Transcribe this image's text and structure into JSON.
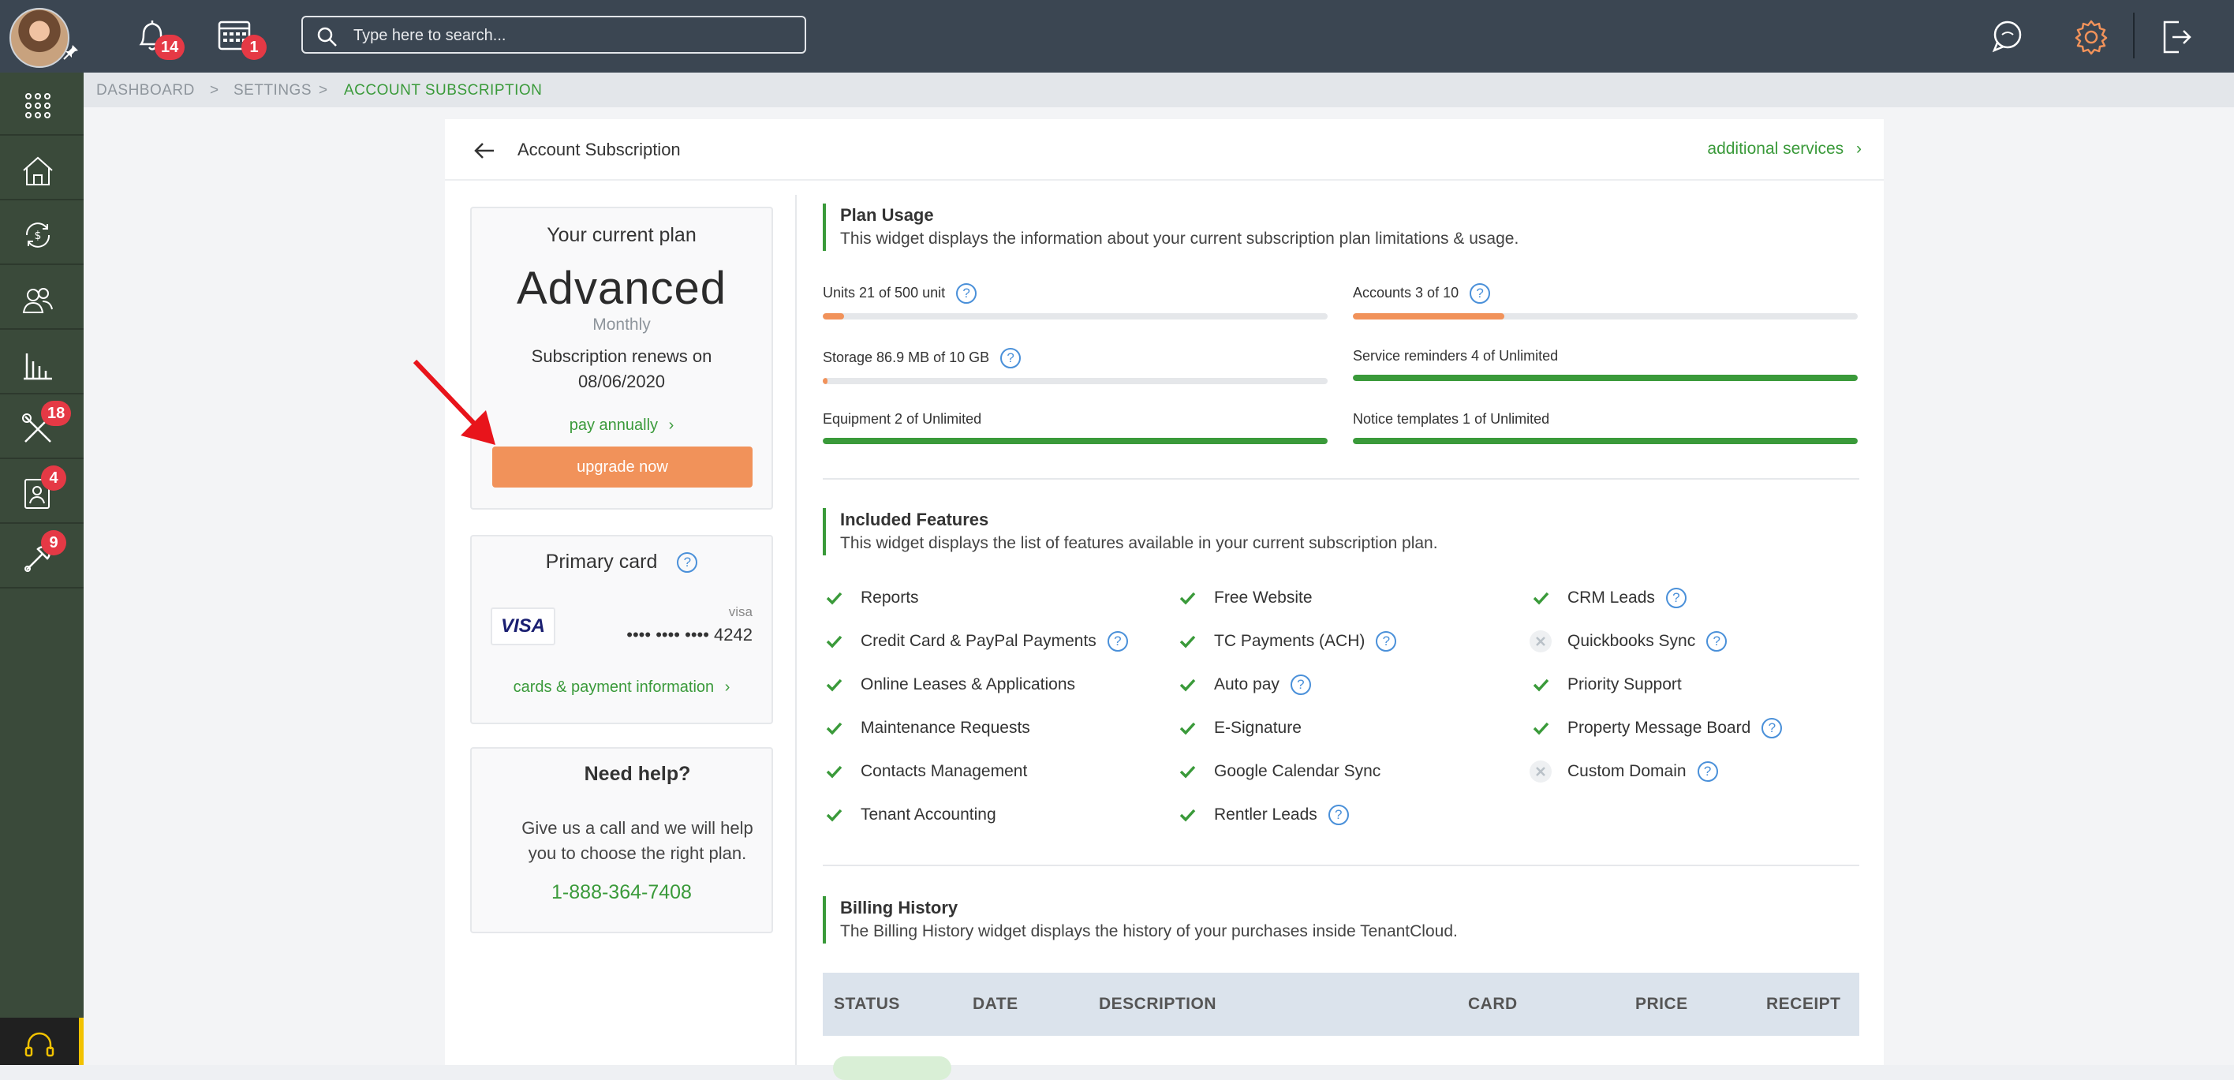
{
  "topbar": {
    "notifications_count": "14",
    "calendar_count": "1",
    "search_placeholder": "Type here to search..."
  },
  "sidebar": {
    "items": [
      {
        "name": "apps-grid-icon",
        "badge": ""
      },
      {
        "name": "properties-icon",
        "badge": ""
      },
      {
        "name": "accounting-icon",
        "badge": ""
      },
      {
        "name": "contacts-icon",
        "badge": ""
      },
      {
        "name": "reports-icon",
        "badge": ""
      },
      {
        "name": "maintenance-icon",
        "badge": "18"
      },
      {
        "name": "applications-icon",
        "badge": "4"
      },
      {
        "name": "tools-icon",
        "badge": "9"
      }
    ]
  },
  "breadcrumb": {
    "dashboard": "DASHBOARD",
    "settings": "SETTINGS",
    "current": "ACCOUNT SUBSCRIPTION",
    "separator": ">"
  },
  "header": {
    "title": "Account Subscription",
    "additional_services": "additional services"
  },
  "plan": {
    "title": "Your current plan",
    "name": "Advanced",
    "period": "Monthly",
    "renews_label": "Subscription renews on",
    "renews_date": "08/06/2020",
    "pay_annually": "pay annually",
    "upgrade": "upgrade now"
  },
  "card": {
    "title": "Primary card",
    "brand_logo": "VISA",
    "brand": "visa",
    "number": "•••• •••• •••• 4242",
    "link": "cards & payment information"
  },
  "help": {
    "title": "Need help?",
    "text_line1": "Give us a call and we will help",
    "text_line2": "you to choose the right plan.",
    "phone": "1-888-364-7408"
  },
  "usage": {
    "title": "Plan Usage",
    "description": "This widget displays the information about your current subscription plan limitations & usage.",
    "items": [
      {
        "label": "Units 21 of 500 unit",
        "help": true,
        "percent": 4.2,
        "color": "#f1925a"
      },
      {
        "label": "Accounts 3 of 10",
        "help": true,
        "percent": 30,
        "color": "#f1925a"
      },
      {
        "label": "Storage 86.9 MB of 10 GB",
        "help": true,
        "percent": 0.9,
        "color": "#f1925a"
      },
      {
        "label": "Service reminders 4 of Unlimited",
        "help": false,
        "percent": 100,
        "color": "#3a9a3a"
      },
      {
        "label": "Equipment 2 of Unlimited",
        "help": false,
        "percent": 100,
        "color": "#3a9a3a"
      },
      {
        "label": "Notice templates 1 of Unlimited",
        "help": false,
        "percent": 100,
        "color": "#3a9a3a"
      }
    ]
  },
  "features": {
    "title": "Included Features",
    "description": "This widget displays the list of features available in your current subscription plan.",
    "columns": [
      [
        {
          "label": "Reports",
          "included": true,
          "help": false
        },
        {
          "label": "Credit Card & PayPal Payments",
          "included": true,
          "help": true
        },
        {
          "label": "Online Leases & Applications",
          "included": true,
          "help": false
        },
        {
          "label": "Maintenance Requests",
          "included": true,
          "help": false
        },
        {
          "label": "Contacts Management",
          "included": true,
          "help": false
        },
        {
          "label": "Tenant Accounting",
          "included": true,
          "help": false
        }
      ],
      [
        {
          "label": "Free Website",
          "included": true,
          "help": false
        },
        {
          "label": "TC Payments (ACH)",
          "included": true,
          "help": true
        },
        {
          "label": "Auto pay",
          "included": true,
          "help": true
        },
        {
          "label": "E-Signature",
          "included": true,
          "help": false
        },
        {
          "label": "Google Calendar Sync",
          "included": true,
          "help": false
        },
        {
          "label": "Rentler Leads",
          "included": true,
          "help": true
        }
      ],
      [
        {
          "label": "CRM Leads",
          "included": true,
          "help": true
        },
        {
          "label": "Quickbooks Sync",
          "included": false,
          "help": true
        },
        {
          "label": "Priority Support",
          "included": true,
          "help": false
        },
        {
          "label": "Property Message Board",
          "included": true,
          "help": true
        },
        {
          "label": "Custom Domain",
          "included": false,
          "help": true
        }
      ]
    ]
  },
  "billing": {
    "title": "Billing History",
    "description": "The Billing History widget displays the history of your purchases inside TenantCloud.",
    "columns": [
      "STATUS",
      "DATE",
      "DESCRIPTION",
      "CARD",
      "PRICE",
      "RECEIPT"
    ]
  },
  "help_glyph": "?",
  "colors": {
    "accent_green": "#3a9a3a",
    "accent_orange": "#f1925a",
    "topbar": "#3b4652",
    "sidebar": "#3a4a3a",
    "badge_red": "#e53945"
  }
}
